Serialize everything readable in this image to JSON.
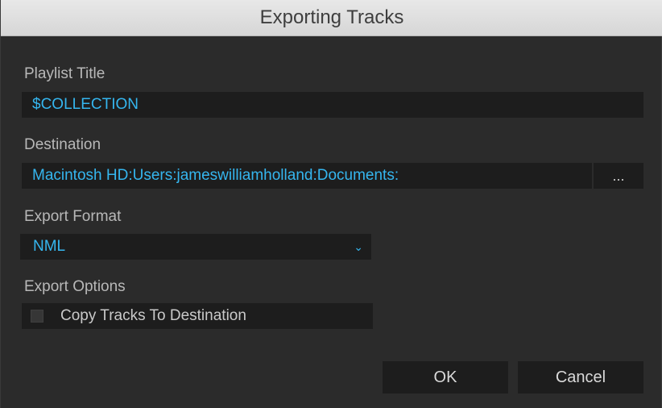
{
  "dialog": {
    "title": "Exporting Tracks"
  },
  "playlist": {
    "label": "Playlist Title",
    "value": "$COLLECTION"
  },
  "destination": {
    "label": "Destination",
    "value": "Macintosh HD:Users:jameswilliamholland:Documents:",
    "browse_label": "..."
  },
  "format": {
    "label": "Export Format",
    "value": "NML",
    "arrow_glyph": "⌄"
  },
  "options": {
    "label": "Export Options",
    "copy_tracks_label": "Copy Tracks To Destination",
    "copy_tracks_checked": false
  },
  "buttons": {
    "ok_label": "OK",
    "cancel_label": "Cancel"
  },
  "colors": {
    "accent": "#35b6ef",
    "background": "#2b2b2b",
    "field": "#1d1d1d"
  }
}
